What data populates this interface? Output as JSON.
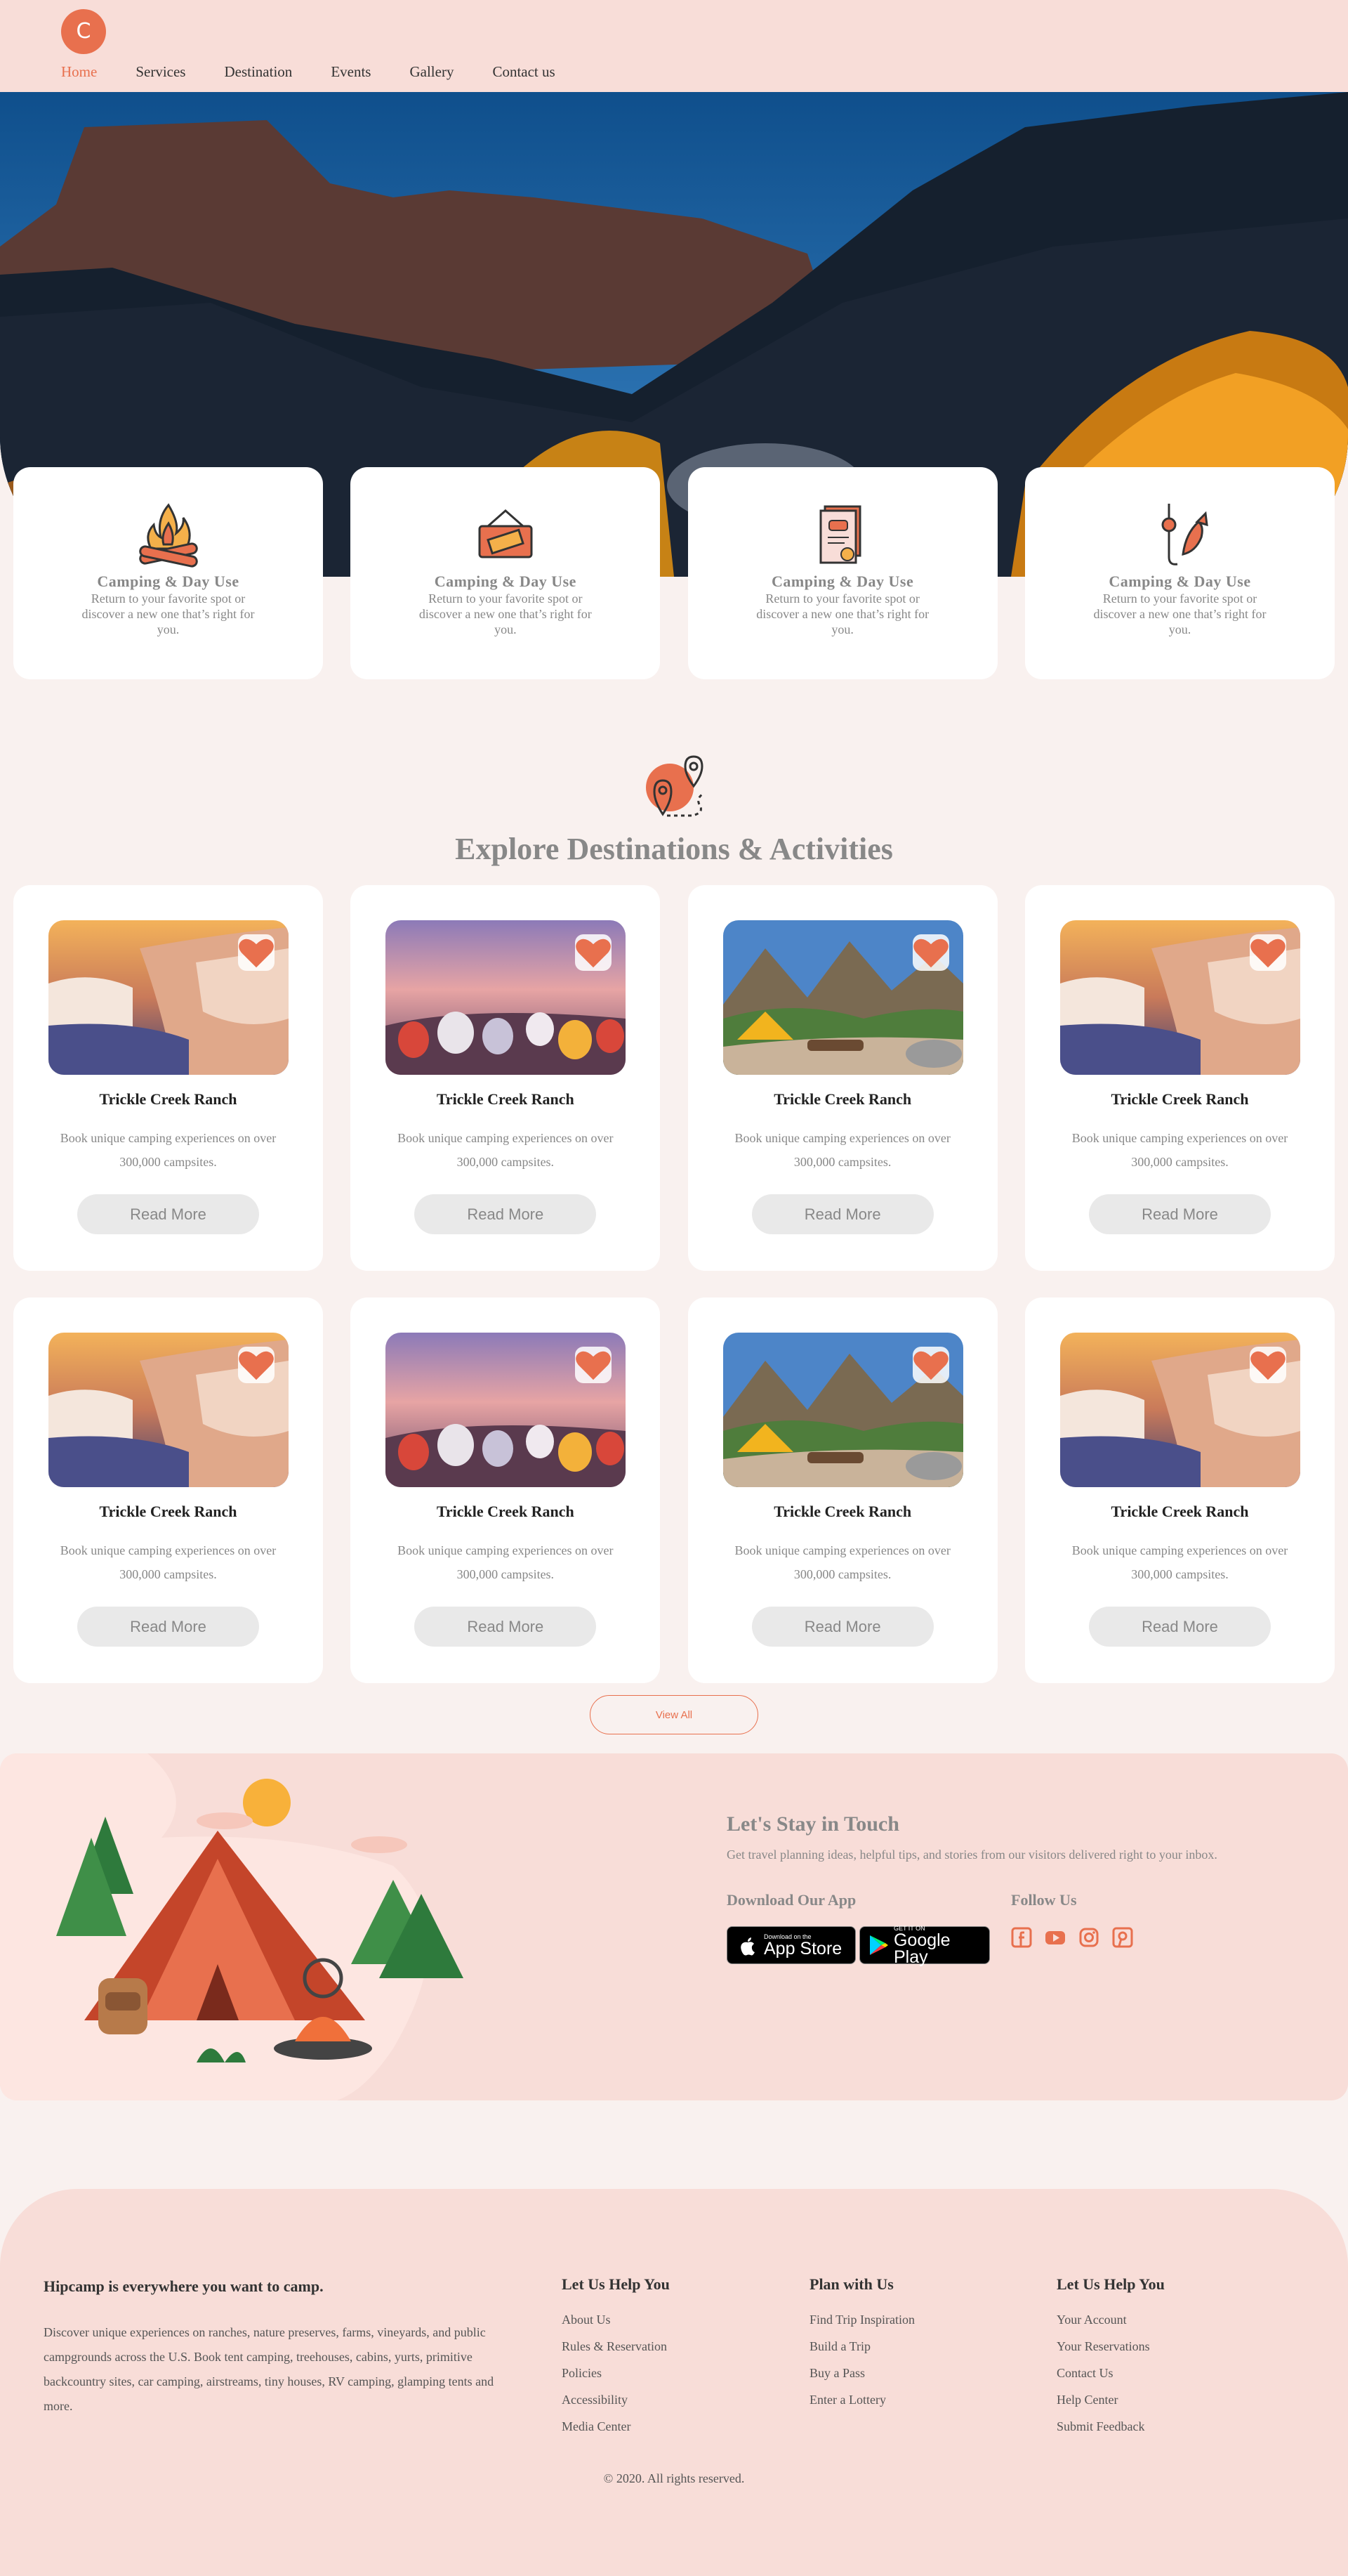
{
  "nav": {
    "logo_letter": "C",
    "links": [
      "Home",
      "Services",
      "Destination",
      "Events",
      "Gallery",
      "Contact us"
    ]
  },
  "features": [
    {
      "icon": "campfire-icon",
      "title": "Camping & Day Use",
      "text": "Return to your favorite spot or discover a new one that’s right for you."
    },
    {
      "icon": "ticket-icon",
      "title": "Camping & Day Use",
      "text": "Return to your favorite spot or discover a new one that’s right for you."
    },
    {
      "icon": "document-icon",
      "title": "Camping & Day Use",
      "text": "Return to your favorite spot or discover a new one that’s right for you."
    },
    {
      "icon": "fishing-icon",
      "title": "Camping & Day Use",
      "text": "Return to your favorite spot or discover a new one that’s right for you."
    }
  ],
  "explore": {
    "title": "Explore Destinations & Activities",
    "icon": "map-pin-icon"
  },
  "destinations": [
    {
      "image": "travertine-terraces",
      "title": "Trickle Creek Ranch",
      "text": "Book unique camping experiences on over 300,000 campsites.",
      "button": "Read More"
    },
    {
      "image": "hot-air-balloons",
      "title": "Trickle Creek Ranch",
      "text": "Book unique camping experiences on over 300,000 campsites.",
      "button": "Read More"
    },
    {
      "image": "mountain-tent",
      "title": "Trickle Creek Ranch",
      "text": "Book unique camping experiences on over 300,000 campsites.",
      "button": "Read More"
    },
    {
      "image": "travertine-terraces",
      "title": "Trickle Creek Ranch",
      "text": "Book unique camping experiences on over 300,000 campsites.",
      "button": "Read More"
    },
    {
      "image": "travertine-terraces",
      "title": "Trickle Creek Ranch",
      "text": "Book unique camping experiences on over 300,000 campsites.",
      "button": "Read More"
    },
    {
      "image": "hot-air-balloons",
      "title": "Trickle Creek Ranch",
      "text": "Book unique camping experiences on over 300,000 campsites.",
      "button": "Read More"
    },
    {
      "image": "mountain-tent",
      "title": "Trickle Creek Ranch",
      "text": "Book unique camping experiences on over 300,000 campsites.",
      "button": "Read More"
    },
    {
      "image": "travertine-terraces",
      "title": "Trickle Creek Ranch",
      "text": "Book unique camping experiences on over 300,000 campsites.",
      "button": "Read More"
    }
  ],
  "view_all": "View All",
  "touch": {
    "title": "Let's Stay in Touch",
    "subtitle": "Get travel planning ideas, helpful tips, and stories from our visitors delivered right to your inbox.",
    "download_title": "Download Our App",
    "follow_title": "Follow Us",
    "app_store_small": "Download on the",
    "app_store_large": "App Store",
    "google_small": "GET IT ON",
    "google_large": "Google Play",
    "social": [
      "facebook-icon",
      "youtube-icon",
      "instagram-icon",
      "pinterest-icon"
    ]
  },
  "footer": {
    "about_title": "Hipcamp is everywhere you want to camp.",
    "about_text": "Discover unique experiences on ranches, nature preserves, farms, vineyards, and public campgrounds across the U.S. Book tent camping, treehouses, cabins, yurts, primitive backcountry sites, car camping, airstreams, tiny houses, RV camping, glamping tents and more.",
    "columns": [
      {
        "title": "Let Us Help You",
        "links": [
          "About Us",
          "Rules & Reservation",
          "Policies",
          "Accessibility",
          "Media Center"
        ]
      },
      {
        "title": "Plan with Us",
        "links": [
          "Find Trip Inspiration",
          "Build a Trip",
          "Buy a Pass",
          "Enter a Lottery"
        ]
      },
      {
        "title": "Let Us Help You",
        "links": [
          "Your Account",
          "Your Reservations",
          "Contact Us",
          "Help Center",
          "Submit Feedback"
        ]
      }
    ],
    "copyright": "© 2020. All rights reserved."
  },
  "colors": {
    "accent": "#e8704e",
    "nav_bg": "#f8ddd8",
    "page_bg": "#f9f1ef"
  }
}
